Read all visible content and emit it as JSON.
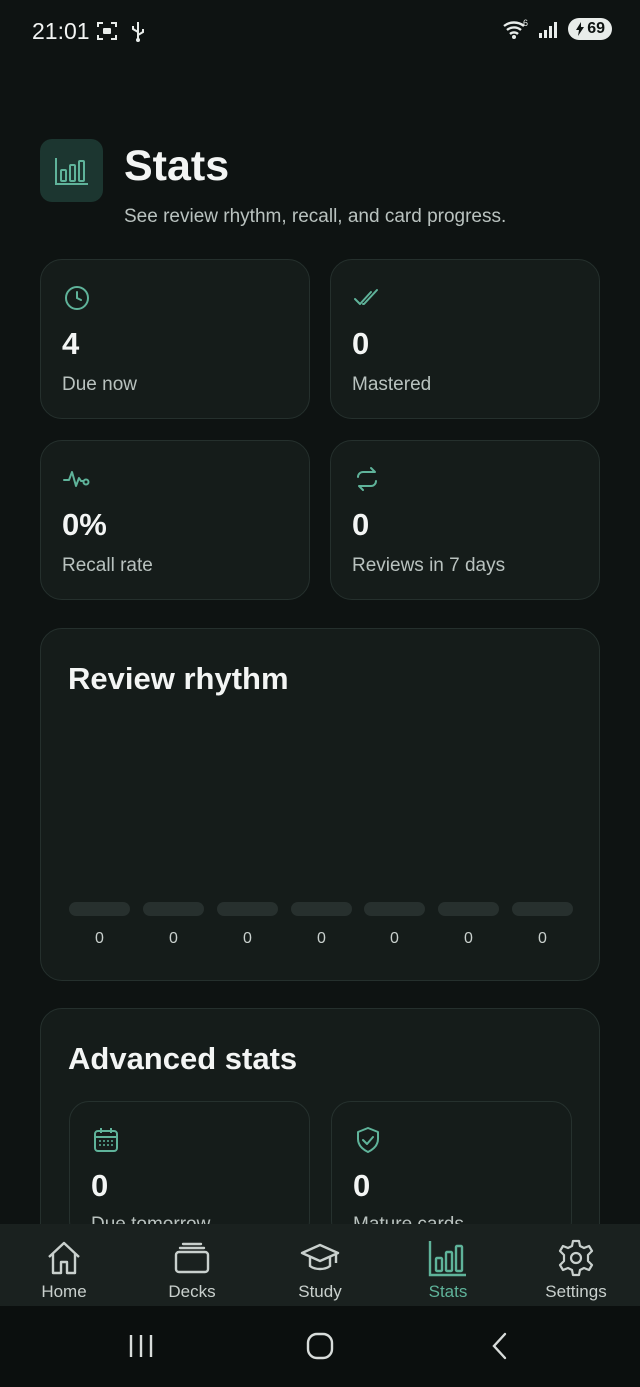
{
  "status_bar": {
    "time": "21:01",
    "battery": "69"
  },
  "header": {
    "title": "Stats",
    "subtitle": "See review rhythm, recall, and card progress."
  },
  "stats": [
    {
      "value": "4",
      "label": "Due now",
      "icon": "clock-icon"
    },
    {
      "value": "0",
      "label": "Mastered",
      "icon": "double-check-icon"
    },
    {
      "value": "0%",
      "label": "Recall rate",
      "icon": "activity-icon"
    },
    {
      "value": "0",
      "label": "Reviews in 7 days",
      "icon": "repeat-icon"
    }
  ],
  "review_rhythm": {
    "title": "Review rhythm",
    "values": [
      "0",
      "0",
      "0",
      "0",
      "0",
      "0",
      "0"
    ]
  },
  "advanced": {
    "title": "Advanced stats",
    "cards": [
      {
        "value": "0",
        "label": "Due tomorrow",
        "icon": "calendar-icon"
      },
      {
        "value": "0",
        "label": "Mature cards",
        "icon": "shield-check-icon"
      }
    ]
  },
  "nav": [
    {
      "label": "Home",
      "icon": "home-icon",
      "active": false
    },
    {
      "label": "Decks",
      "icon": "decks-icon",
      "active": false
    },
    {
      "label": "Study",
      "icon": "graduation-cap-icon",
      "active": false
    },
    {
      "label": "Stats",
      "icon": "bar-chart-icon",
      "active": true
    },
    {
      "label": "Settings",
      "icon": "gear-icon",
      "active": false
    }
  ],
  "colors": {
    "accent": "#5fb39a",
    "background": "#0e1312",
    "card": "#151c1a"
  }
}
